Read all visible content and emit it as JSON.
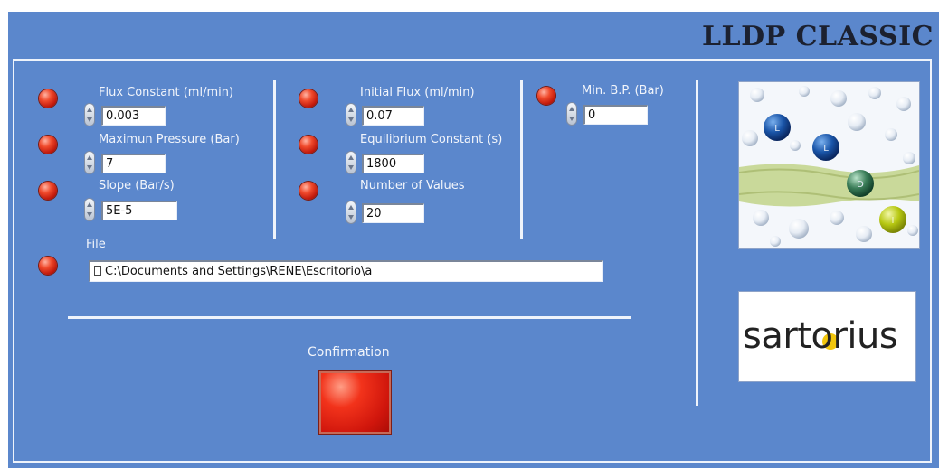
{
  "app": {
    "title": "LLDP CLASSIC"
  },
  "params": {
    "flux_constant": {
      "label": "Flux Constant (ml/min)",
      "value": "0.003"
    },
    "max_pressure": {
      "label": "Maximun Pressure (Bar)",
      "value": "7"
    },
    "slope": {
      "label": "Slope (Bar/s)",
      "value": "5E-5"
    },
    "initial_flux": {
      "label": "Initial Flux (ml/min)",
      "value": "0.07"
    },
    "equilibrium_constant": {
      "label": "Equilibrium Constant (s)",
      "value": "1800"
    },
    "number_of_values": {
      "label": "Number of Values",
      "value": "20"
    },
    "min_bp": {
      "label": "Min. B.P. (Bar)",
      "value": "0"
    }
  },
  "file": {
    "label": "File",
    "value": "C:\\Documents and Settings\\RENE\\Escritorio\\a"
  },
  "confirmation": {
    "label": "Confirmation"
  },
  "molecule_image": {
    "labels": [
      "L",
      "L",
      "D",
      "I"
    ]
  },
  "logo": {
    "text": "sartorius"
  },
  "colors": {
    "background": "#5b87cc",
    "led": "#e8321c",
    "logo_accent": "#f2c60c"
  },
  "icons": [
    "led-indicator",
    "spinner-arrows",
    "path-icon"
  ]
}
